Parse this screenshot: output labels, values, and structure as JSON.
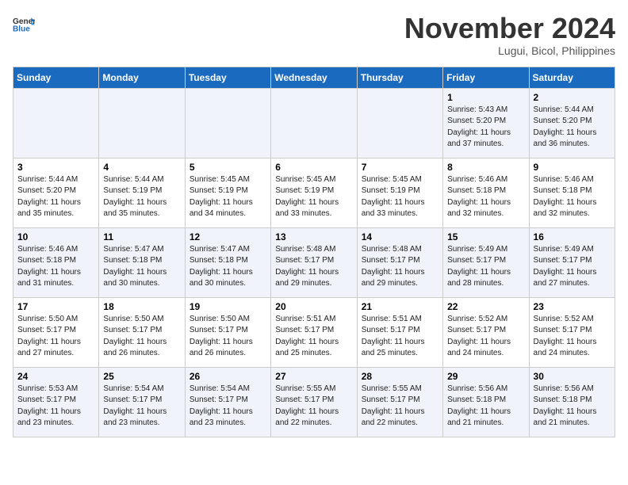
{
  "header": {
    "logo_line1": "General",
    "logo_line2": "Blue",
    "month": "November 2024",
    "location": "Lugui, Bicol, Philippines"
  },
  "weekdays": [
    "Sunday",
    "Monday",
    "Tuesday",
    "Wednesday",
    "Thursday",
    "Friday",
    "Saturday"
  ],
  "weeks": [
    [
      {
        "day": "",
        "info": ""
      },
      {
        "day": "",
        "info": ""
      },
      {
        "day": "",
        "info": ""
      },
      {
        "day": "",
        "info": ""
      },
      {
        "day": "",
        "info": ""
      },
      {
        "day": "1",
        "info": "Sunrise: 5:43 AM\nSunset: 5:20 PM\nDaylight: 11 hours\nand 37 minutes."
      },
      {
        "day": "2",
        "info": "Sunrise: 5:44 AM\nSunset: 5:20 PM\nDaylight: 11 hours\nand 36 minutes."
      }
    ],
    [
      {
        "day": "3",
        "info": "Sunrise: 5:44 AM\nSunset: 5:20 PM\nDaylight: 11 hours\nand 35 minutes."
      },
      {
        "day": "4",
        "info": "Sunrise: 5:44 AM\nSunset: 5:19 PM\nDaylight: 11 hours\nand 35 minutes."
      },
      {
        "day": "5",
        "info": "Sunrise: 5:45 AM\nSunset: 5:19 PM\nDaylight: 11 hours\nand 34 minutes."
      },
      {
        "day": "6",
        "info": "Sunrise: 5:45 AM\nSunset: 5:19 PM\nDaylight: 11 hours\nand 33 minutes."
      },
      {
        "day": "7",
        "info": "Sunrise: 5:45 AM\nSunset: 5:19 PM\nDaylight: 11 hours\nand 33 minutes."
      },
      {
        "day": "8",
        "info": "Sunrise: 5:46 AM\nSunset: 5:18 PM\nDaylight: 11 hours\nand 32 minutes."
      },
      {
        "day": "9",
        "info": "Sunrise: 5:46 AM\nSunset: 5:18 PM\nDaylight: 11 hours\nand 32 minutes."
      }
    ],
    [
      {
        "day": "10",
        "info": "Sunrise: 5:46 AM\nSunset: 5:18 PM\nDaylight: 11 hours\nand 31 minutes."
      },
      {
        "day": "11",
        "info": "Sunrise: 5:47 AM\nSunset: 5:18 PM\nDaylight: 11 hours\nand 30 minutes."
      },
      {
        "day": "12",
        "info": "Sunrise: 5:47 AM\nSunset: 5:18 PM\nDaylight: 11 hours\nand 30 minutes."
      },
      {
        "day": "13",
        "info": "Sunrise: 5:48 AM\nSunset: 5:17 PM\nDaylight: 11 hours\nand 29 minutes."
      },
      {
        "day": "14",
        "info": "Sunrise: 5:48 AM\nSunset: 5:17 PM\nDaylight: 11 hours\nand 29 minutes."
      },
      {
        "day": "15",
        "info": "Sunrise: 5:49 AM\nSunset: 5:17 PM\nDaylight: 11 hours\nand 28 minutes."
      },
      {
        "day": "16",
        "info": "Sunrise: 5:49 AM\nSunset: 5:17 PM\nDaylight: 11 hours\nand 27 minutes."
      }
    ],
    [
      {
        "day": "17",
        "info": "Sunrise: 5:50 AM\nSunset: 5:17 PM\nDaylight: 11 hours\nand 27 minutes."
      },
      {
        "day": "18",
        "info": "Sunrise: 5:50 AM\nSunset: 5:17 PM\nDaylight: 11 hours\nand 26 minutes."
      },
      {
        "day": "19",
        "info": "Sunrise: 5:50 AM\nSunset: 5:17 PM\nDaylight: 11 hours\nand 26 minutes."
      },
      {
        "day": "20",
        "info": "Sunrise: 5:51 AM\nSunset: 5:17 PM\nDaylight: 11 hours\nand 25 minutes."
      },
      {
        "day": "21",
        "info": "Sunrise: 5:51 AM\nSunset: 5:17 PM\nDaylight: 11 hours\nand 25 minutes."
      },
      {
        "day": "22",
        "info": "Sunrise: 5:52 AM\nSunset: 5:17 PM\nDaylight: 11 hours\nand 24 minutes."
      },
      {
        "day": "23",
        "info": "Sunrise: 5:52 AM\nSunset: 5:17 PM\nDaylight: 11 hours\nand 24 minutes."
      }
    ],
    [
      {
        "day": "24",
        "info": "Sunrise: 5:53 AM\nSunset: 5:17 PM\nDaylight: 11 hours\nand 23 minutes."
      },
      {
        "day": "25",
        "info": "Sunrise: 5:54 AM\nSunset: 5:17 PM\nDaylight: 11 hours\nand 23 minutes."
      },
      {
        "day": "26",
        "info": "Sunrise: 5:54 AM\nSunset: 5:17 PM\nDaylight: 11 hours\nand 23 minutes."
      },
      {
        "day": "27",
        "info": "Sunrise: 5:55 AM\nSunset: 5:17 PM\nDaylight: 11 hours\nand 22 minutes."
      },
      {
        "day": "28",
        "info": "Sunrise: 5:55 AM\nSunset: 5:17 PM\nDaylight: 11 hours\nand 22 minutes."
      },
      {
        "day": "29",
        "info": "Sunrise: 5:56 AM\nSunset: 5:18 PM\nDaylight: 11 hours\nand 21 minutes."
      },
      {
        "day": "30",
        "info": "Sunrise: 5:56 AM\nSunset: 5:18 PM\nDaylight: 11 hours\nand 21 minutes."
      }
    ]
  ]
}
